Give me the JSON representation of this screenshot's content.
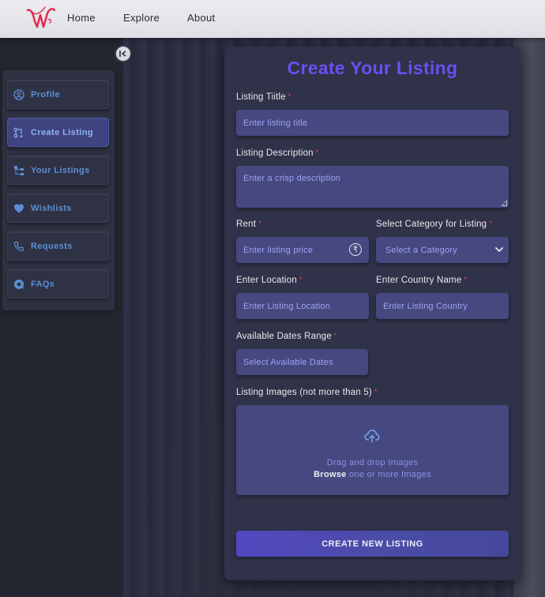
{
  "navbar": {
    "links": [
      "Home",
      "Explore",
      "About"
    ]
  },
  "sidebar": {
    "items": [
      {
        "label": "Profile",
        "icon": "user-circle-icon"
      },
      {
        "label": "Create Listing",
        "icon": "git-pull-request-icon"
      },
      {
        "label": "Your Listings",
        "icon": "sitemap-icon"
      },
      {
        "label": "Wishlists",
        "icon": "heart-icon"
      },
      {
        "label": "Requests",
        "icon": "phone-icon"
      },
      {
        "label": "FAQs",
        "icon": "chat-bubble-icon"
      }
    ],
    "active": "Create Listing"
  },
  "form": {
    "title": "Create Your Listing",
    "title_label": "Listing Tiitle",
    "title_placeholder": "Enter listing title",
    "desc_label": "Listing Description",
    "desc_placeholder": "Enter a crisp description",
    "rent_label": "Rent",
    "rent_placeholder": "Enter listing price",
    "category_label": "Select Category for Listing",
    "category_value": "Select a Category",
    "location_label": "Enter Location",
    "location_placeholder": "Enter Listing Location",
    "country_label": "Enter Country Name",
    "country_placeholder": "Enter Listing Country",
    "dates_label": "Available Dates Range",
    "dates_placeholder": "Select Available Dates",
    "images_label": "Listing Images (not more than 5)",
    "drop_text": "Drag and drop Images",
    "browse_text": "Browse",
    "browse_suffix": " one or more Images",
    "submit_label": "CREATE NEW LISTING",
    "required_mark": "*",
    "currency_symbol": "₹"
  },
  "colors": {
    "accent_title": "#6b4ff0",
    "sidebar_text": "#5b8fd6",
    "field_bg": "#46497f",
    "required": "#e04868"
  }
}
